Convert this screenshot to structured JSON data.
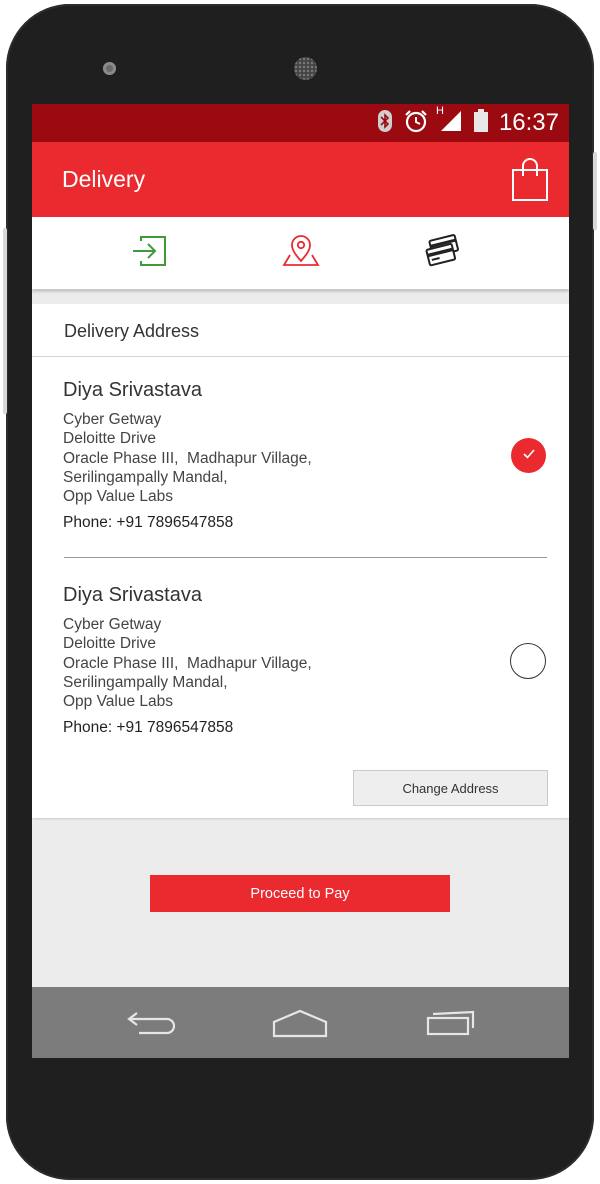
{
  "status_bar": {
    "time": "16:37",
    "network_label": "H",
    "icons": [
      "bluetooth-icon",
      "alarm-icon",
      "signal-icon",
      "battery-icon"
    ]
  },
  "app_bar": {
    "title": "Delivery",
    "action_icon": "shopping-bag-icon"
  },
  "steps": [
    {
      "icon": "login-icon",
      "color": "#3f9a3a"
    },
    {
      "icon": "map-pin-icon",
      "color": "#eb2a30"
    },
    {
      "icon": "credit-cards-icon",
      "color": "#222222"
    }
  ],
  "section": {
    "title": "Delivery Address"
  },
  "addresses": [
    {
      "name": "Diya Srivastava",
      "lines": [
        "Cyber Getway",
        "Deloitte Drive",
        "Oracle Phase III,  Madhapur Village,",
        "Serilingampally Mandal,",
        "Opp Value Labs"
      ],
      "phone": "Phone: +91 7896547858",
      "selected": true
    },
    {
      "name": "Diya Srivastava",
      "lines": [
        "Cyber Getway",
        "Deloitte Drive",
        "Oracle Phase III,  Madhapur Village,",
        "Serilingampally Mandal,",
        "Opp Value Labs"
      ],
      "phone": "Phone: +91 7896547858",
      "selected": false
    }
  ],
  "buttons": {
    "change_address": "Change Address",
    "proceed": "Proceed to Pay"
  },
  "colors": {
    "status_bar": "#9b0a10",
    "accent": "#eb2a30",
    "nav_bar": "#7c7c7c"
  },
  "nav": [
    "back-icon",
    "home-icon",
    "recents-icon"
  ]
}
